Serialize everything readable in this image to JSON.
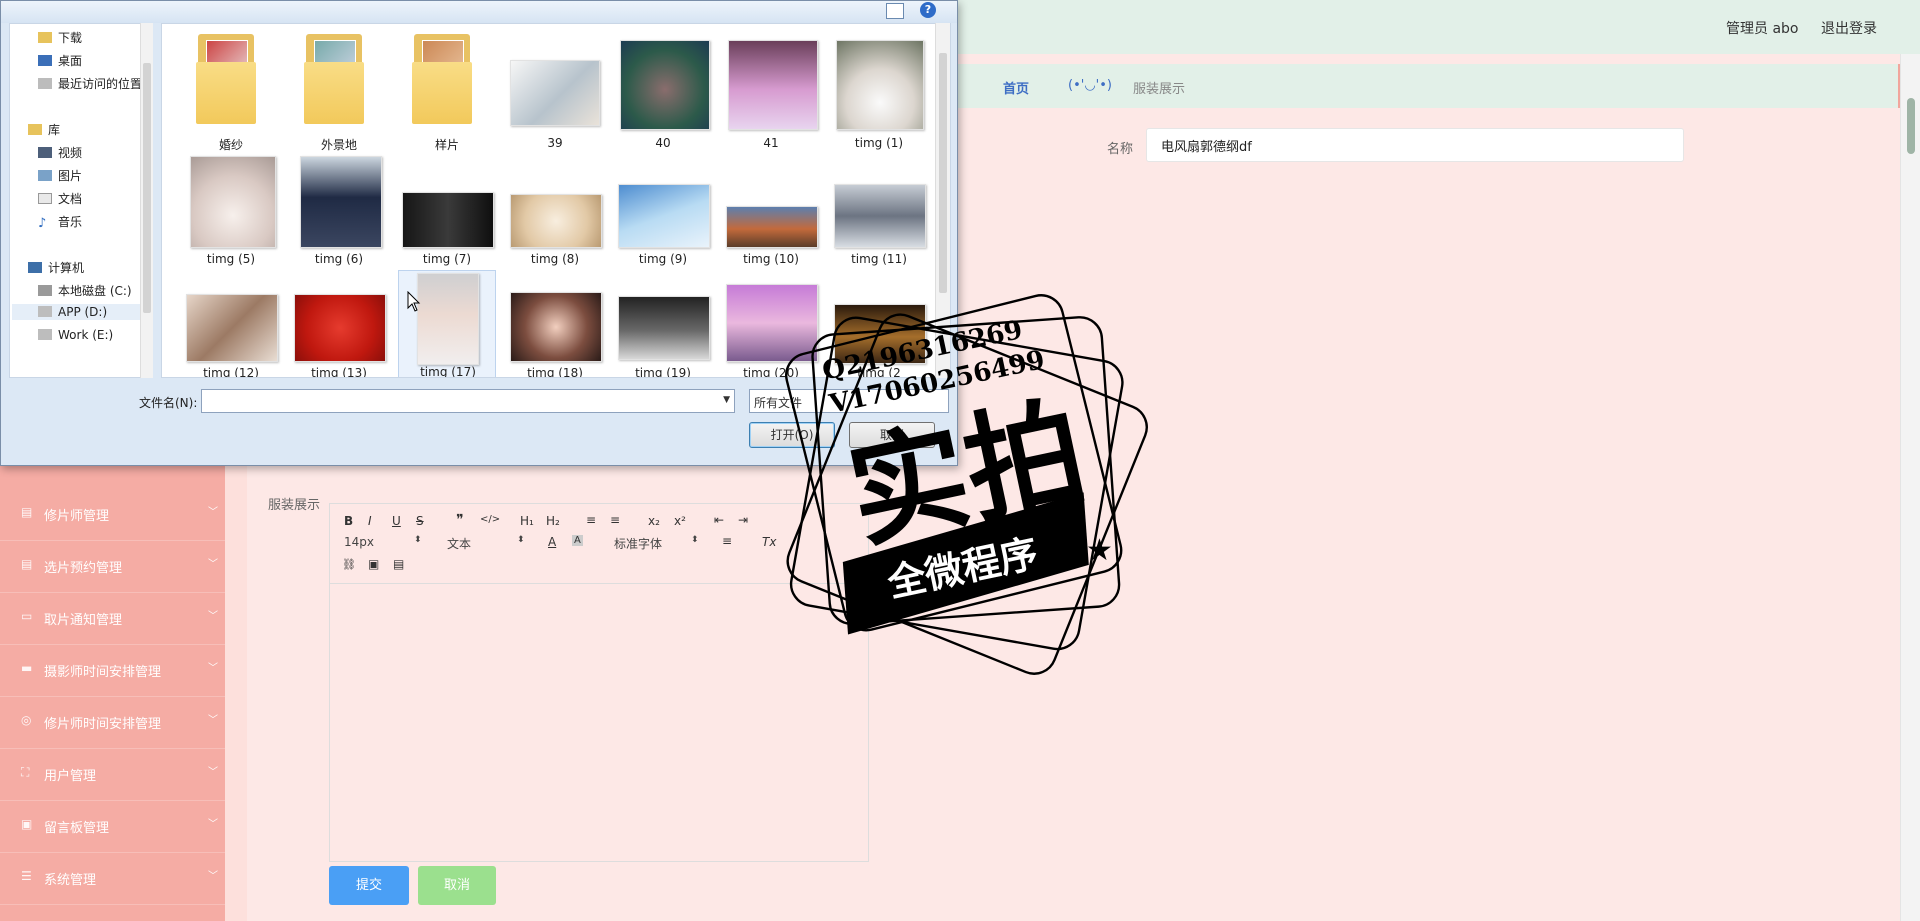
{
  "header": {
    "admin_label": "管理员 abo",
    "logout_label": "退出登录"
  },
  "breadcrumb": {
    "home": "首页",
    "face": "(•'◡'•)",
    "current": "服装展示"
  },
  "form": {
    "name_label": "名称",
    "name_value": "电风扇郭德纲df",
    "content_label": "服装展示",
    "submit_label": "提交",
    "cancel_label": "取消"
  },
  "editor": {
    "toolbar": {
      "bold": "B",
      "italic": "I",
      "underline": "U",
      "strike": "S",
      "quote": "❞",
      "code": "</>",
      "h1": "H₁",
      "h2": "H₂",
      "ordered_list": "≡",
      "bullet_list": "≡",
      "subscript": "x₂",
      "superscript": "x²",
      "outdent": "⇤",
      "indent": "⇥",
      "size": "14px",
      "header_select": "文本",
      "font_select": "标准字体",
      "align": "≡",
      "clean": "Tx",
      "link": "🔗",
      "image": "▣",
      "video": "▤"
    }
  },
  "sidebar": {
    "items": [
      {
        "label": "修片师管理",
        "icon": "doc-icon"
      },
      {
        "label": "选片预约管理",
        "icon": "doc-icon"
      },
      {
        "label": "取片通知管理",
        "icon": "chat-icon"
      },
      {
        "label": "摄影师时间安排管理",
        "icon": "chat-icon"
      },
      {
        "label": "修片师时间安排管理",
        "icon": "globe-icon"
      },
      {
        "label": "用户管理",
        "icon": "expand-icon"
      },
      {
        "label": "留言板管理",
        "icon": "clipboard-icon"
      },
      {
        "label": "系统管理",
        "icon": "sliders-icon"
      }
    ]
  },
  "dialog": {
    "nav": {
      "downloads": "下载",
      "desktop": "桌面",
      "recent": "最近访问的位置",
      "libraries": "库",
      "videos": "视频",
      "pictures": "图片",
      "documents": "文档",
      "music": "音乐",
      "computer": "计算机",
      "drive_c": "本地磁盘 (C:)",
      "drive_d": "APP (D:)",
      "drive_e": "Work (E:)"
    },
    "files": [
      {
        "name": "婚纱",
        "kind": "folder"
      },
      {
        "name": "外景地",
        "kind": "folder"
      },
      {
        "name": "样片",
        "kind": "folder"
      },
      {
        "name": "39",
        "kind": "image"
      },
      {
        "name": "40",
        "kind": "image"
      },
      {
        "name": "41",
        "kind": "image"
      },
      {
        "name": "timg (1)",
        "kind": "image"
      },
      {
        "name": "timg (5)",
        "kind": "image"
      },
      {
        "name": "timg (6)",
        "kind": "image"
      },
      {
        "name": "timg (7)",
        "kind": "image"
      },
      {
        "name": "timg (8)",
        "kind": "image"
      },
      {
        "name": "timg (9)",
        "kind": "image"
      },
      {
        "name": "timg (10)",
        "kind": "image"
      },
      {
        "name": "timg (11)",
        "kind": "image"
      },
      {
        "name": "timg (12)",
        "kind": "image"
      },
      {
        "name": "timg (13)",
        "kind": "image"
      },
      {
        "name": "timg (17)",
        "kind": "image"
      },
      {
        "name": "timg (18)",
        "kind": "image"
      },
      {
        "name": "timg (19)",
        "kind": "image"
      },
      {
        "name": "timg (20)",
        "kind": "image"
      },
      {
        "name": "timg (2",
        "kind": "image"
      }
    ],
    "filename_label": "文件名(N):",
    "filename_value": "",
    "filetype_value": "所有文件",
    "open_label": "打开(O)",
    "cancel_label": "取消",
    "help_label": "?"
  },
  "watermark": {
    "contact_q": "Q2196316269",
    "contact_v": "V17060256499",
    "main_text": "实拍",
    "banner_text": "全微程序"
  },
  "colors": {
    "sidebar": "#f5aca4",
    "content_bg": "#fde8e6",
    "header_bg": "#e2f0e8",
    "submit": "#4a9ff5",
    "cancel": "#9be08e",
    "link": "#3e6ec4"
  }
}
